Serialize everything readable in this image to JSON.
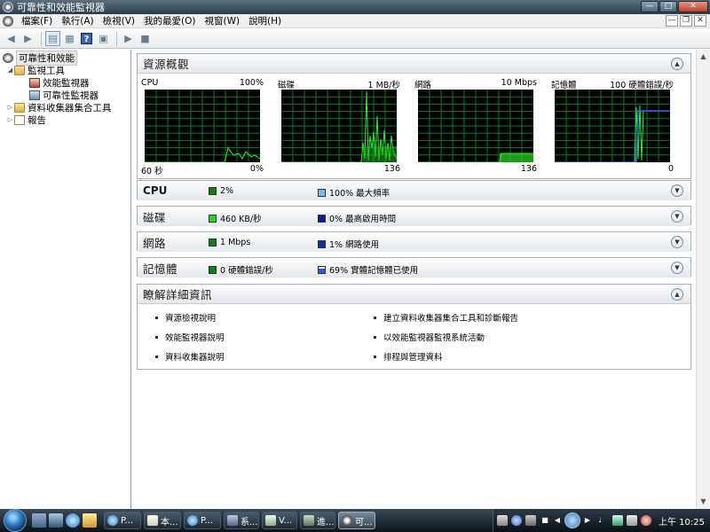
{
  "window": {
    "title": "可靠性和效能監視器"
  },
  "menu": [
    "檔案(F)",
    "執行(A)",
    "檢視(V)",
    "我的最愛(O)",
    "視窗(W)",
    "說明(H)"
  ],
  "tree": {
    "root": "可靠性和效能",
    "monitoring_tools": "監視工具",
    "performance_monitor": "效能監視器",
    "reliability_monitor": "可靠性監視器",
    "data_collector_sets": "資料收集器集合工具",
    "reports": "報告"
  },
  "overview": {
    "title": "資源概觀",
    "graphs": [
      {
        "label": "CPU",
        "top_right": "100%",
        "bottom_left": "60 秒",
        "bottom_right": "0%"
      },
      {
        "label": "磁碟",
        "top_right": "1 MB/秒",
        "bottom_left": "",
        "bottom_right": "136"
      },
      {
        "label": "網路",
        "top_right": "10 Mbps",
        "bottom_left": "",
        "bottom_right": "136"
      },
      {
        "label": "記憶體",
        "top_right": "100 硬體錯誤/秒",
        "bottom_left": "",
        "bottom_right": "0"
      }
    ]
  },
  "sections": {
    "cpu": {
      "title": "CPU",
      "stat1": "2%",
      "stat2": "100% 最大頻率",
      "color1": "#1a7a1a",
      "color2": "#7ab8f0"
    },
    "disk": {
      "title": "磁碟",
      "stat1": "460 KB/秒",
      "stat2": "0% 最高啟用時間",
      "color1": "#2ad52a",
      "color2": "#0a1aa0"
    },
    "network": {
      "title": "網路",
      "stat1": "1 Mbps",
      "stat2": "1% 網路使用",
      "color1": "#1a7a1a",
      "color2": "#1a2ab0"
    },
    "memory": {
      "title": "記憶體",
      "stat1": "0 硬體錯誤/秒",
      "stat2": "69% 實體記憶體已使用",
      "color1": "#1a7a1a",
      "color2": "#2a5ad8"
    }
  },
  "learn_more": {
    "title": "瞭解詳細資訊",
    "left": [
      "資源檢視說明",
      "效能監視器說明",
      "資料收集器說明"
    ],
    "right": [
      "建立資料收集器集合工具和診斷報告",
      "以效能監視器監視系統活動",
      "排程與管理資料"
    ]
  },
  "taskbar": {
    "tasks": [
      "P...",
      "本...",
      "P...",
      "系...",
      "V...",
      "進...",
      "可..."
    ],
    "clock": "上午 10:25"
  }
}
